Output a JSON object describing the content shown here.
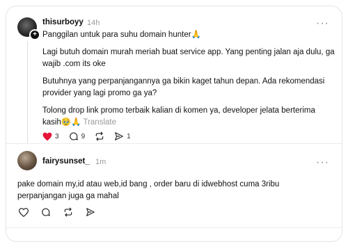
{
  "post": {
    "username": "thisurboyy",
    "time": "14h",
    "more": "···",
    "line1": "Panggilan untuk para suhu domain hunter🙏",
    "para1": "Lagi butuh domain murah meriah buat service app. Yang penting jalan aja dulu, ga wajib .com its oke",
    "para2": "Butuhnya yang perpanjangannya ga bikin kaget tahun depan. Ada rekomendasi provider yang lagi promo ga ya?",
    "para3": "Tolong drop link promo terbaik kalian di komen ya, developer jelata berterima kasih🥹🙏",
    "translate": "Translate",
    "likes": "3",
    "comments": "9",
    "shares": "1",
    "like_color": "#e4163a"
  },
  "reply": {
    "username": "fairysunset_",
    "time": "1m",
    "more": "···",
    "text": "pake domain my,id atau web,id bang , order baru di idwebhost cuma 3ribu perpanjangan juga ga mahal"
  }
}
